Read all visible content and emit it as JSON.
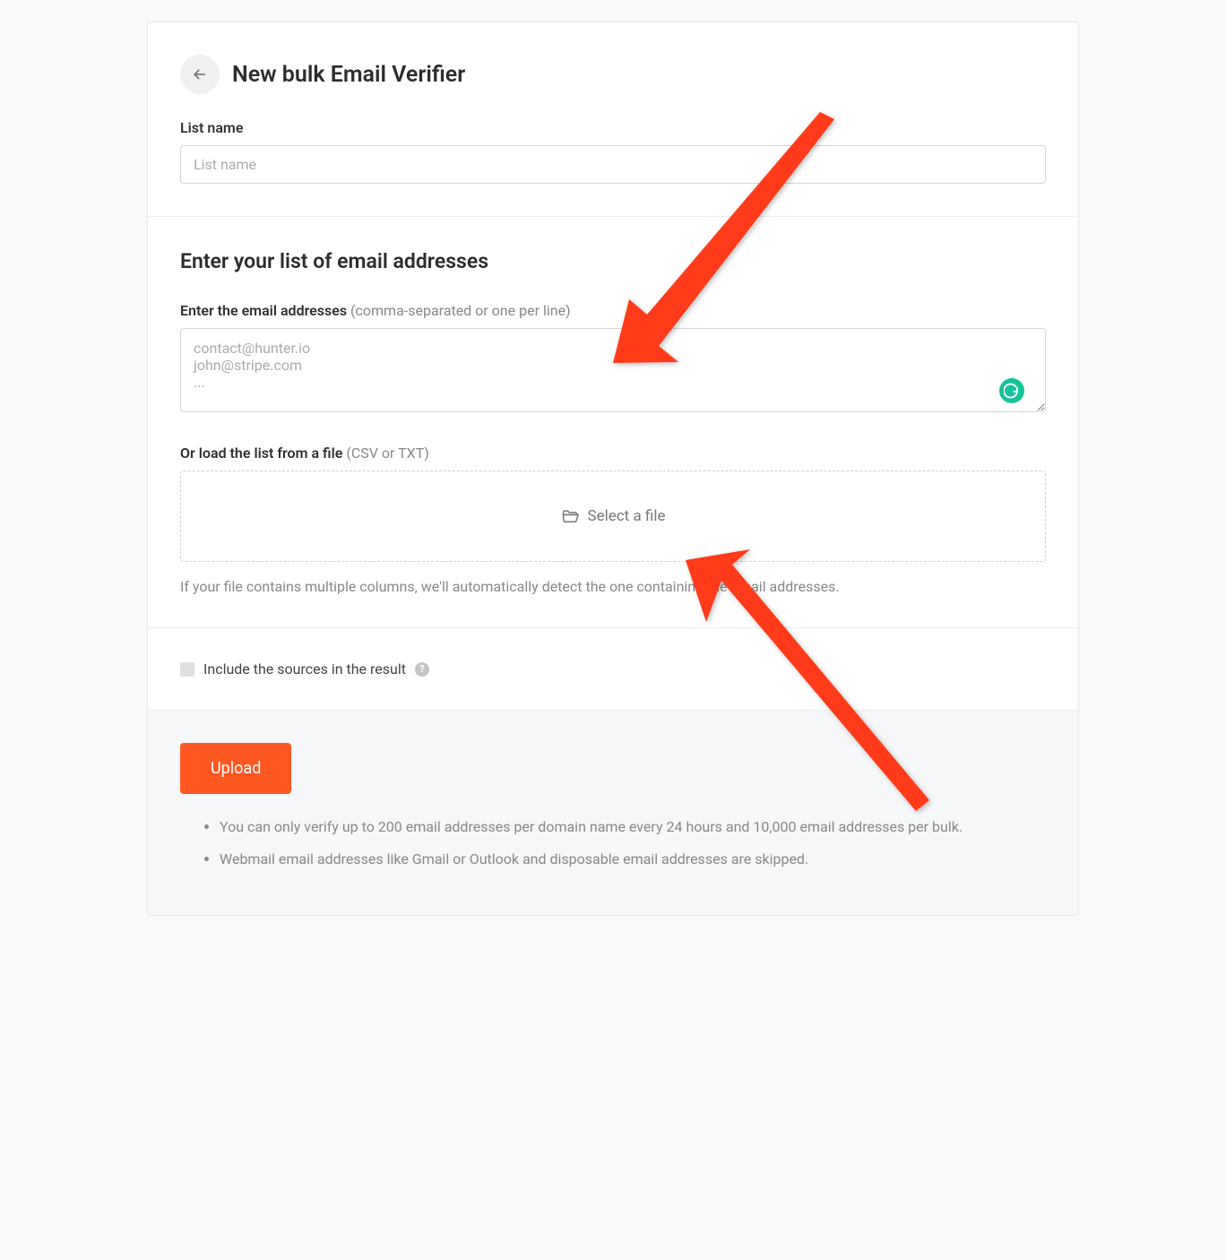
{
  "header": {
    "title": "New bulk Email Verifier"
  },
  "listName": {
    "label": "List name",
    "placeholder": "List name"
  },
  "emailSection": {
    "heading": "Enter your list of email addresses",
    "textareaLabel": "Enter the email addresses",
    "textareaHint": " (comma-separated or one per line)",
    "textareaPlaceholder": "contact@hunter.io\njohn@stripe.com\n...",
    "fileLabel": "Or load the list from a file",
    "fileHint": " (CSV or TXT)",
    "fileButton": "Select a file",
    "fileHelp": "If your file contains multiple columns, we'll automatically detect the one containing the email addresses."
  },
  "options": {
    "includeSources": "Include the sources in the result"
  },
  "actions": {
    "upload": "Upload"
  },
  "notes": {
    "bullet1": "You can only verify up to 200 email addresses per domain name every 24 hours and 10,000 email addresses per bulk.",
    "bullet2": "Webmail email addresses like Gmail or Outlook and disposable email addresses are skipped."
  },
  "icons": {
    "helpGlyph": "?"
  }
}
